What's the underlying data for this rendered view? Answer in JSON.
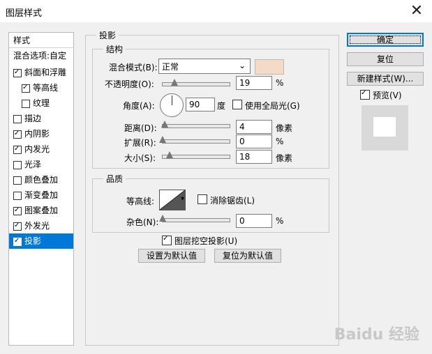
{
  "window": {
    "title": "图层样式",
    "close_symbol": "✕"
  },
  "sidebar": {
    "header": "样式",
    "blend_options": "混合选项:自定",
    "items": [
      {
        "label": "斜面和浮雕",
        "checked": true
      },
      {
        "label": "等高线",
        "checked": true
      },
      {
        "label": "纹理",
        "checked": false
      },
      {
        "label": "描边",
        "checked": false
      },
      {
        "label": "内阴影",
        "checked": true
      },
      {
        "label": "内发光",
        "checked": true
      },
      {
        "label": "光泽",
        "checked": false
      },
      {
        "label": "颜色叠加",
        "checked": false
      },
      {
        "label": "渐变叠加",
        "checked": false
      },
      {
        "label": "图案叠加",
        "checked": true
      },
      {
        "label": "外发光",
        "checked": true
      },
      {
        "label": "投影",
        "checked": true,
        "selected": true
      }
    ]
  },
  "panel": {
    "title": "投影",
    "structure": {
      "title": "结构",
      "blend_mode_label": "混合模式(B):",
      "blend_mode_value": "正常",
      "shadow_color": "#f3dbc7",
      "opacity_label": "不透明度(O):",
      "opacity_value": "19",
      "opacity_unit": "%",
      "angle_label": "角度(A):",
      "angle_value": "90",
      "angle_unit": "度",
      "global_light_label": "使用全局光(G)",
      "global_light_checked": false,
      "distance_label": "距离(D):",
      "distance_value": "4",
      "distance_unit": "像素",
      "spread_label": "扩展(R):",
      "spread_value": "0",
      "spread_unit": "%",
      "size_label": "大小(S):",
      "size_value": "18",
      "size_unit": "像素"
    },
    "quality": {
      "title": "品质",
      "contour_label": "等高线:",
      "antialias_label": "消除锯齿(L)",
      "antialias_checked": false,
      "noise_label": "杂色(N):",
      "noise_value": "0",
      "noise_unit": "%"
    },
    "knockout_label": "图层挖空投影(U)",
    "knockout_checked": true,
    "make_default_label": "设置为默认值",
    "reset_default_label": "复位为默认值"
  },
  "actions": {
    "ok_label": "确定",
    "reset_label": "复位",
    "new_style_label": "新建样式(W)...",
    "preview_label": "预览(V)",
    "preview_checked": true
  },
  "watermark": "Baidu 经验"
}
